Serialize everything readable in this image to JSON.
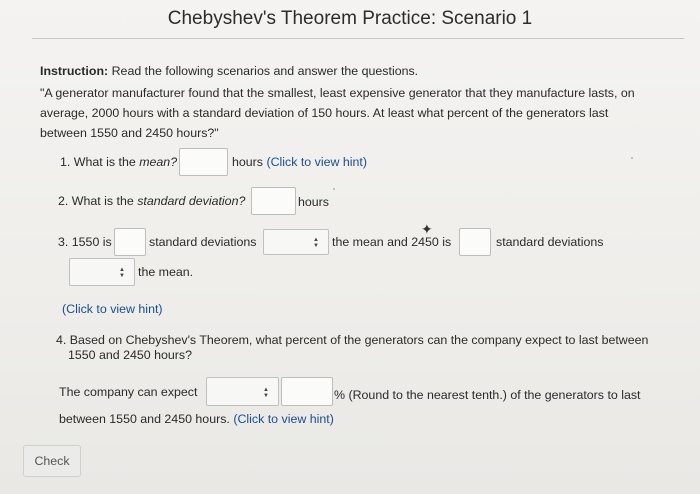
{
  "header": {
    "title": "Chebyshev's Theorem Practice: Scenario 1"
  },
  "instruction": {
    "label": "Instruction:",
    "text": "Read the following scenarios and answer the questions."
  },
  "scenario": {
    "line1": "\"A generator manufacturer found that the smallest, least expensive generator that they manufacture lasts, on",
    "line2": "average, 2000 hours with a standard deviation of 150 hours. At least what percent of the generators last",
    "line3": "between 1550 and 2450 hours?\""
  },
  "q1": {
    "prefix": "1. What is the ",
    "italic": "mean?",
    "value": "",
    "suffix": "hours",
    "hint": "(Click to view hint)"
  },
  "q2": {
    "prefix": "2. What is the ",
    "italic": "standard deviation?",
    "value": "",
    "suffix": "hours"
  },
  "q3": {
    "prefix": "3. 1550 is",
    "value1": "",
    "mid1": "standard deviations",
    "dropdown1": "",
    "mid2": "the mean and 2450 is",
    "value2": "",
    "mid3": "standard deviations",
    "dropdown2": "",
    "end": "the mean.",
    "hint": "(Click to view hint)"
  },
  "q4": {
    "line1": "4. Based on Chebyshev's Theorem, what percent of the generators can the company expect to last between",
    "line2": "1550 and 2450 hours?",
    "answer_prefix": "The company can expect",
    "dropdown": "",
    "value": "",
    "answer_suffix": "% (Round to the nearest tenth.) of the generators to last",
    "line4": "between 1550 and 2450 hours.",
    "hint": "(Click to view hint)"
  },
  "footer": {
    "check_label": "Check"
  },
  "icons": {
    "dropdown_caret": "updown-caret-icon",
    "cursor": "mouse-pointer-icon"
  }
}
